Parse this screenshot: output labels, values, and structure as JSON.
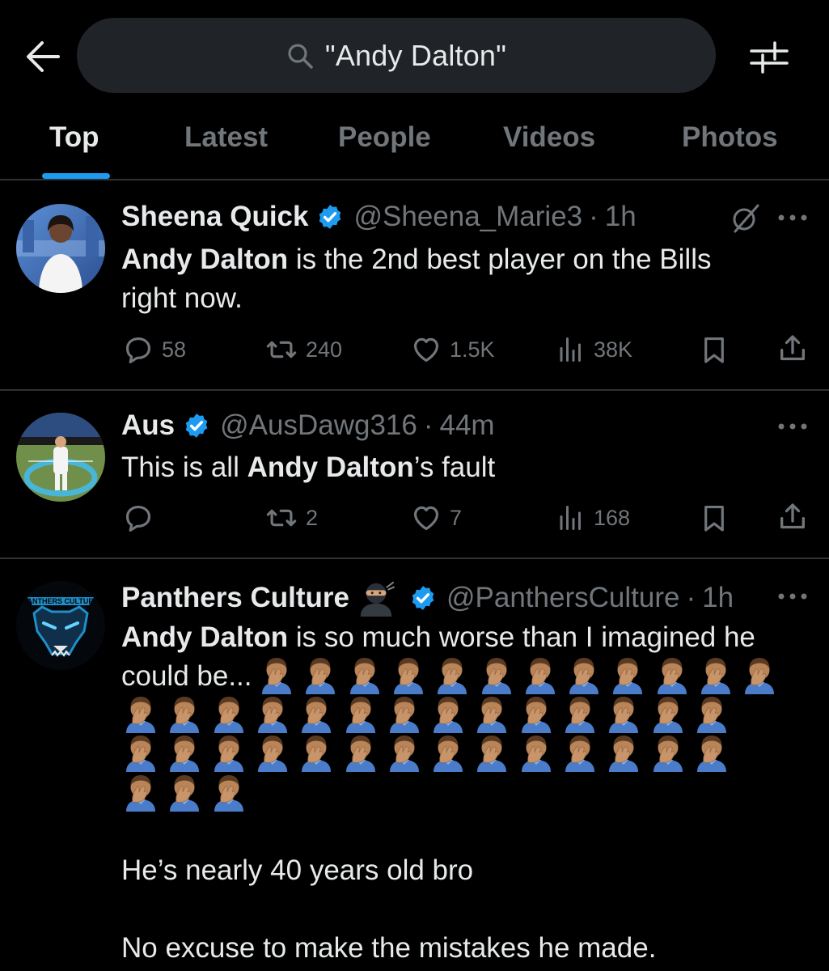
{
  "search": {
    "query": "\"Andy Dalton\""
  },
  "tabs": [
    {
      "label": "Top",
      "active": true
    },
    {
      "label": "Latest",
      "active": false
    },
    {
      "label": "People",
      "active": false
    },
    {
      "label": "Videos",
      "active": false
    },
    {
      "label": "Photos",
      "active": false
    }
  ],
  "colors": {
    "accent": "#1d9bf0",
    "muted": "#71767b",
    "text": "#e7e9ea",
    "background": "#000000",
    "search_bg": "#202327",
    "divider": "#2f3336"
  },
  "tweets": [
    {
      "name": "Sheena Quick",
      "verified": true,
      "handle": "@Sheena_Marie3",
      "time": "1h",
      "text_bold": "Andy Dalton",
      "text_rest": " is the 2nd best player on the Bills",
      "text_line2": "right now.",
      "replies": "58",
      "retweets": "240",
      "likes": "1.5K",
      "views": "38K",
      "extra_icon": "grok-slash-icon"
    },
    {
      "name": "Aus",
      "verified": true,
      "handle": "@AusDawg316",
      "time": "44m",
      "text_pre": "This is all ",
      "text_bold": "Andy Dalton",
      "text_post": "’s fault",
      "replies": "",
      "retweets": "2",
      "likes": "7",
      "views": "168"
    },
    {
      "name": "Panthers Culture",
      "name_emoji": "ninja",
      "verified": true,
      "handle": "@PanthersCulture",
      "time": "1h",
      "avatar_text": "PANTHERS CULTURE",
      "text_bold": "Andy Dalton",
      "text_rest": " is so much worse than I imagined he",
      "text_line2": "could be...",
      "facepalm_emoji_count": 43,
      "paragraph2": "He’s nearly 40 years old bro",
      "paragraph3": "No excuse to make the mistakes he made."
    }
  ],
  "icons": [
    "back-arrow-icon",
    "search-icon",
    "filter-icon",
    "verified-badge-icon",
    "more-icon",
    "reply-icon",
    "retweet-icon",
    "like-icon",
    "views-icon",
    "bookmark-icon",
    "share-icon",
    "facepalm-emoji-icon",
    "ninja-emoji-icon"
  ]
}
